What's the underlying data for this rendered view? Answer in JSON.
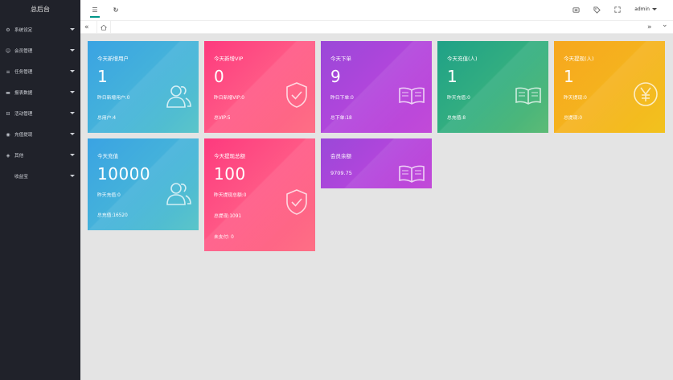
{
  "sidebar": {
    "title": "总后台",
    "items": [
      {
        "label": "系统设定",
        "icon": "gear-icon",
        "glyph": "⚙"
      },
      {
        "label": "会员管理",
        "icon": "user-icon",
        "glyph": "☺"
      },
      {
        "label": "任务管理",
        "icon": "list-icon",
        "glyph": "≡"
      },
      {
        "label": "报表数据",
        "icon": "chart-icon",
        "glyph": "▬"
      },
      {
        "label": "活动管理",
        "icon": "car-icon",
        "glyph": "⊟"
      },
      {
        "label": "充值提现",
        "icon": "circle-icon",
        "glyph": "◉"
      },
      {
        "label": "其他",
        "icon": "eye-icon",
        "glyph": "◈"
      },
      {
        "label": "收益宝",
        "icon": "",
        "glyph": ""
      }
    ]
  },
  "header": {
    "menu_glyph": "☰",
    "refresh_glyph": "↻",
    "admin_label": "admin",
    "icons": [
      "theme-icon",
      "tag-icon",
      "fullscreen-icon"
    ]
  },
  "tabs": {
    "prev_glyph": "«",
    "next_glyph": "»",
    "down_glyph": "⌄",
    "home_glyph": "⌂"
  },
  "cards": {
    "new_users": {
      "title": "今天新增用户",
      "value": "1",
      "line1": "昨日新增用户:0",
      "line2": "总用户:4"
    },
    "new_vip": {
      "title": "今天新增VIP",
      "value": "0",
      "line1": "昨日新增VIP:0",
      "line2": "总VIP:5"
    },
    "orders": {
      "title": "今天下单",
      "value": "9",
      "line1": "昨日下单:0",
      "line2": "总下单:18"
    },
    "recharge_people": {
      "title": "今天充值(人)",
      "value": "1",
      "line1": "昨天充值:0",
      "line2": "总充值:8"
    },
    "withdraw_people": {
      "title": "今天提现(人)",
      "value": "1",
      "line1": "昨天提现:0",
      "line2": "总提现:0"
    },
    "recharge": {
      "title": "今天充值",
      "value": "10000",
      "line1": "昨天充值:0",
      "line2": "总充值:16520"
    },
    "withdraw_total": {
      "title": "今天提现总额",
      "value": "100",
      "line1": "昨天提现总额:0",
      "line2": "总提现:1091",
      "line3": "未支付: 0"
    },
    "balance": {
      "title": "会员余额",
      "value": "9709.75"
    }
  },
  "colors": {
    "sidebar": "#20222a",
    "blue": "#3aa3e3",
    "pink": "#fd3a7e",
    "purple": "#9a48d8",
    "green": "#1fa187",
    "yellow": "#f6a71f",
    "accent": "#009688"
  }
}
